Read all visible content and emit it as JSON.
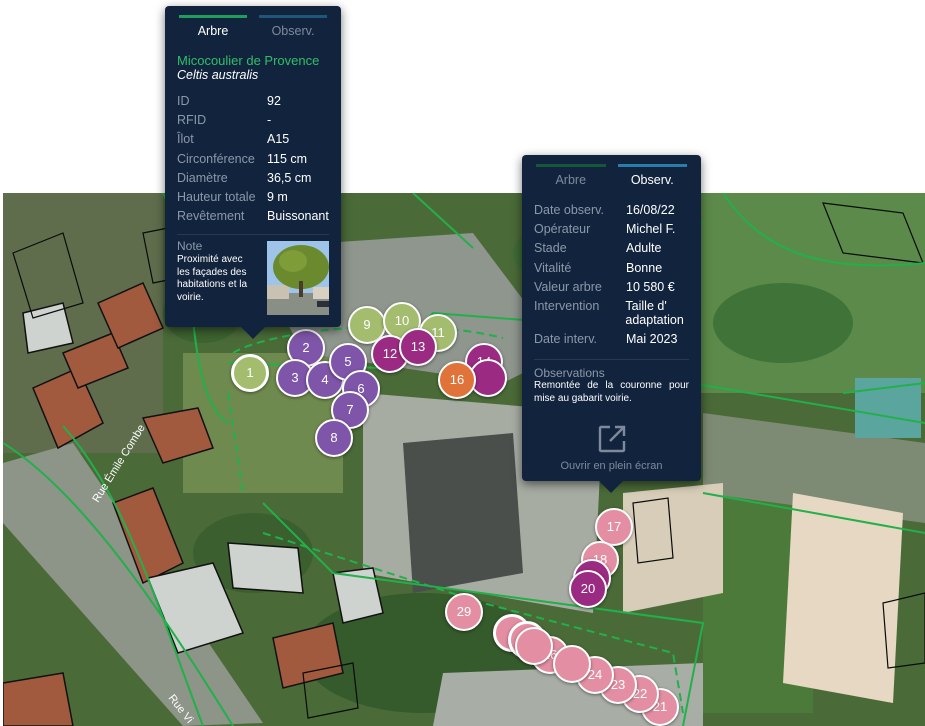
{
  "tree_popup": {
    "tabs": {
      "tree": "Arbre",
      "obs": "Observ."
    },
    "common_name": "Micocoulier de Provence",
    "scientific_name": "Celtis australis",
    "fields": [
      {
        "key": "ID",
        "value": "92"
      },
      {
        "key": "RFID",
        "value": "-"
      },
      {
        "key": "Îlot",
        "value": "A15"
      },
      {
        "key": "Circonférence",
        "value": "115 cm"
      },
      {
        "key": "Diamètre",
        "value": "36,5 cm"
      },
      {
        "key": "Hauteur totale",
        "value": "9 m"
      },
      {
        "key": "Revêtement",
        "value": "Buissonant"
      }
    ],
    "note_label": "Note",
    "note_text": "Proximité avec les façades des habitations et la voirie."
  },
  "obs_popup": {
    "tabs": {
      "tree": "Arbre",
      "obs": "Observ."
    },
    "fields": [
      {
        "key": "Date observ.",
        "value": "16/08/22"
      },
      {
        "key": "Opérateur",
        "value": "Michel F."
      },
      {
        "key": "Stade",
        "value": "Adulte"
      },
      {
        "key": "Vitalité",
        "value": "Bonne"
      },
      {
        "key": "Valeur arbre",
        "value": "10 580 €"
      },
      {
        "key": "Intervention",
        "value": "Taille d' adaptation"
      },
      {
        "key": "Date interv.",
        "value": "Mai 2023"
      }
    ],
    "observations_label": "Observations",
    "observations_text": "Remontée de la couronne pour mise au gabarit voirie.",
    "fullscreen_label": "Ouvrir en plein écran",
    "fullscreen_icon": "open-external-icon"
  },
  "map": {
    "street_labels": [
      "Rue Émile Combe",
      "Rue Vi"
    ],
    "colors": {
      "green": "#a3bc6e",
      "purple": "#7e55a8",
      "magenta": "#9b2a83",
      "orange": "#e0733a",
      "pink": "#e38ea3",
      "popup_bg": "#12243d",
      "parcel_line": "#22b04a"
    },
    "markers": [
      {
        "label": "1",
        "color": "green"
      },
      {
        "label": "2",
        "color": "purple"
      },
      {
        "label": "3",
        "color": "purple"
      },
      {
        "label": "4",
        "color": "purple"
      },
      {
        "label": "5",
        "color": "purple"
      },
      {
        "label": "6",
        "color": "purple"
      },
      {
        "label": "7",
        "color": "purple"
      },
      {
        "label": "8",
        "color": "purple"
      },
      {
        "label": "9",
        "color": "green"
      },
      {
        "label": "10",
        "color": "green"
      },
      {
        "label": "11",
        "color": "green"
      },
      {
        "label": "12",
        "color": "magenta"
      },
      {
        "label": "13",
        "color": "magenta"
      },
      {
        "label": "14",
        "color": "magenta"
      },
      {
        "label": "16",
        "color": "orange"
      },
      {
        "label": "17",
        "color": "pink"
      },
      {
        "label": "18",
        "color": "pink"
      },
      {
        "label": "20",
        "color": "magenta"
      },
      {
        "label": "21",
        "color": "pink"
      },
      {
        "label": "22",
        "color": "pink"
      },
      {
        "label": "23",
        "color": "pink"
      },
      {
        "label": "24",
        "color": "pink"
      },
      {
        "label": "26",
        "color": "pink"
      },
      {
        "label": "27",
        "color": "pink"
      },
      {
        "label": "29",
        "color": "pink"
      }
    ]
  }
}
